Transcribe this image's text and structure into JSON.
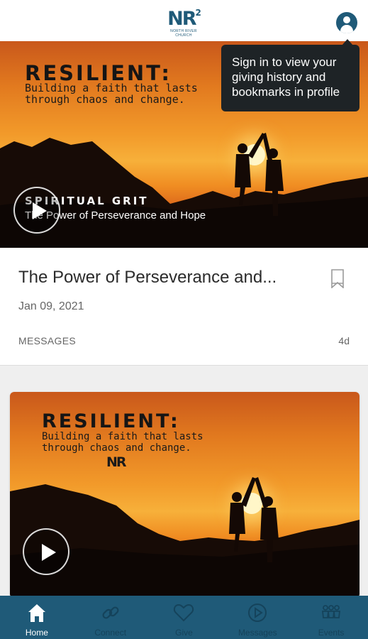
{
  "header": {
    "logo_mark": "NR",
    "logo_superscript": "2",
    "logo_text_line1": "NORTH RIVER",
    "logo_text_line2": "CHURCH",
    "avatar_icon": "user-icon"
  },
  "tooltip": {
    "text": "Sign in to view your giving history and bookmarks in profile"
  },
  "hero": {
    "title": "RESILIENT:",
    "subtitle": "Building a faith that lasts\nthrough chaos and change.",
    "series_name": "SPIRITUAL GRIT",
    "series_subtitle": "The Power of Perseverance and Hope"
  },
  "card1": {
    "title": "The Power of Perseverance and...",
    "date": "Jan 09, 2021",
    "category": "MESSAGES",
    "age": "4d",
    "bookmark_icon": "bookmark-icon"
  },
  "card2": {
    "title": "RESILIENT:",
    "subtitle": "Building a faith that lasts\nthrough chaos and change.",
    "logo_mark": "NR"
  },
  "tabbar": {
    "tabs": [
      {
        "label": "Home",
        "icon": "home-icon",
        "active": true
      },
      {
        "label": "Connect",
        "icon": "link-icon",
        "active": false
      },
      {
        "label": "Give",
        "icon": "heart-icon",
        "active": false
      },
      {
        "label": "Messages",
        "icon": "play-circle-icon",
        "active": false
      },
      {
        "label": "Events",
        "icon": "people-icon",
        "active": false
      }
    ]
  },
  "colors": {
    "brand": "#1f5a78",
    "tooltip_bg": "#1e2326",
    "tab_inactive": "#15435b"
  }
}
